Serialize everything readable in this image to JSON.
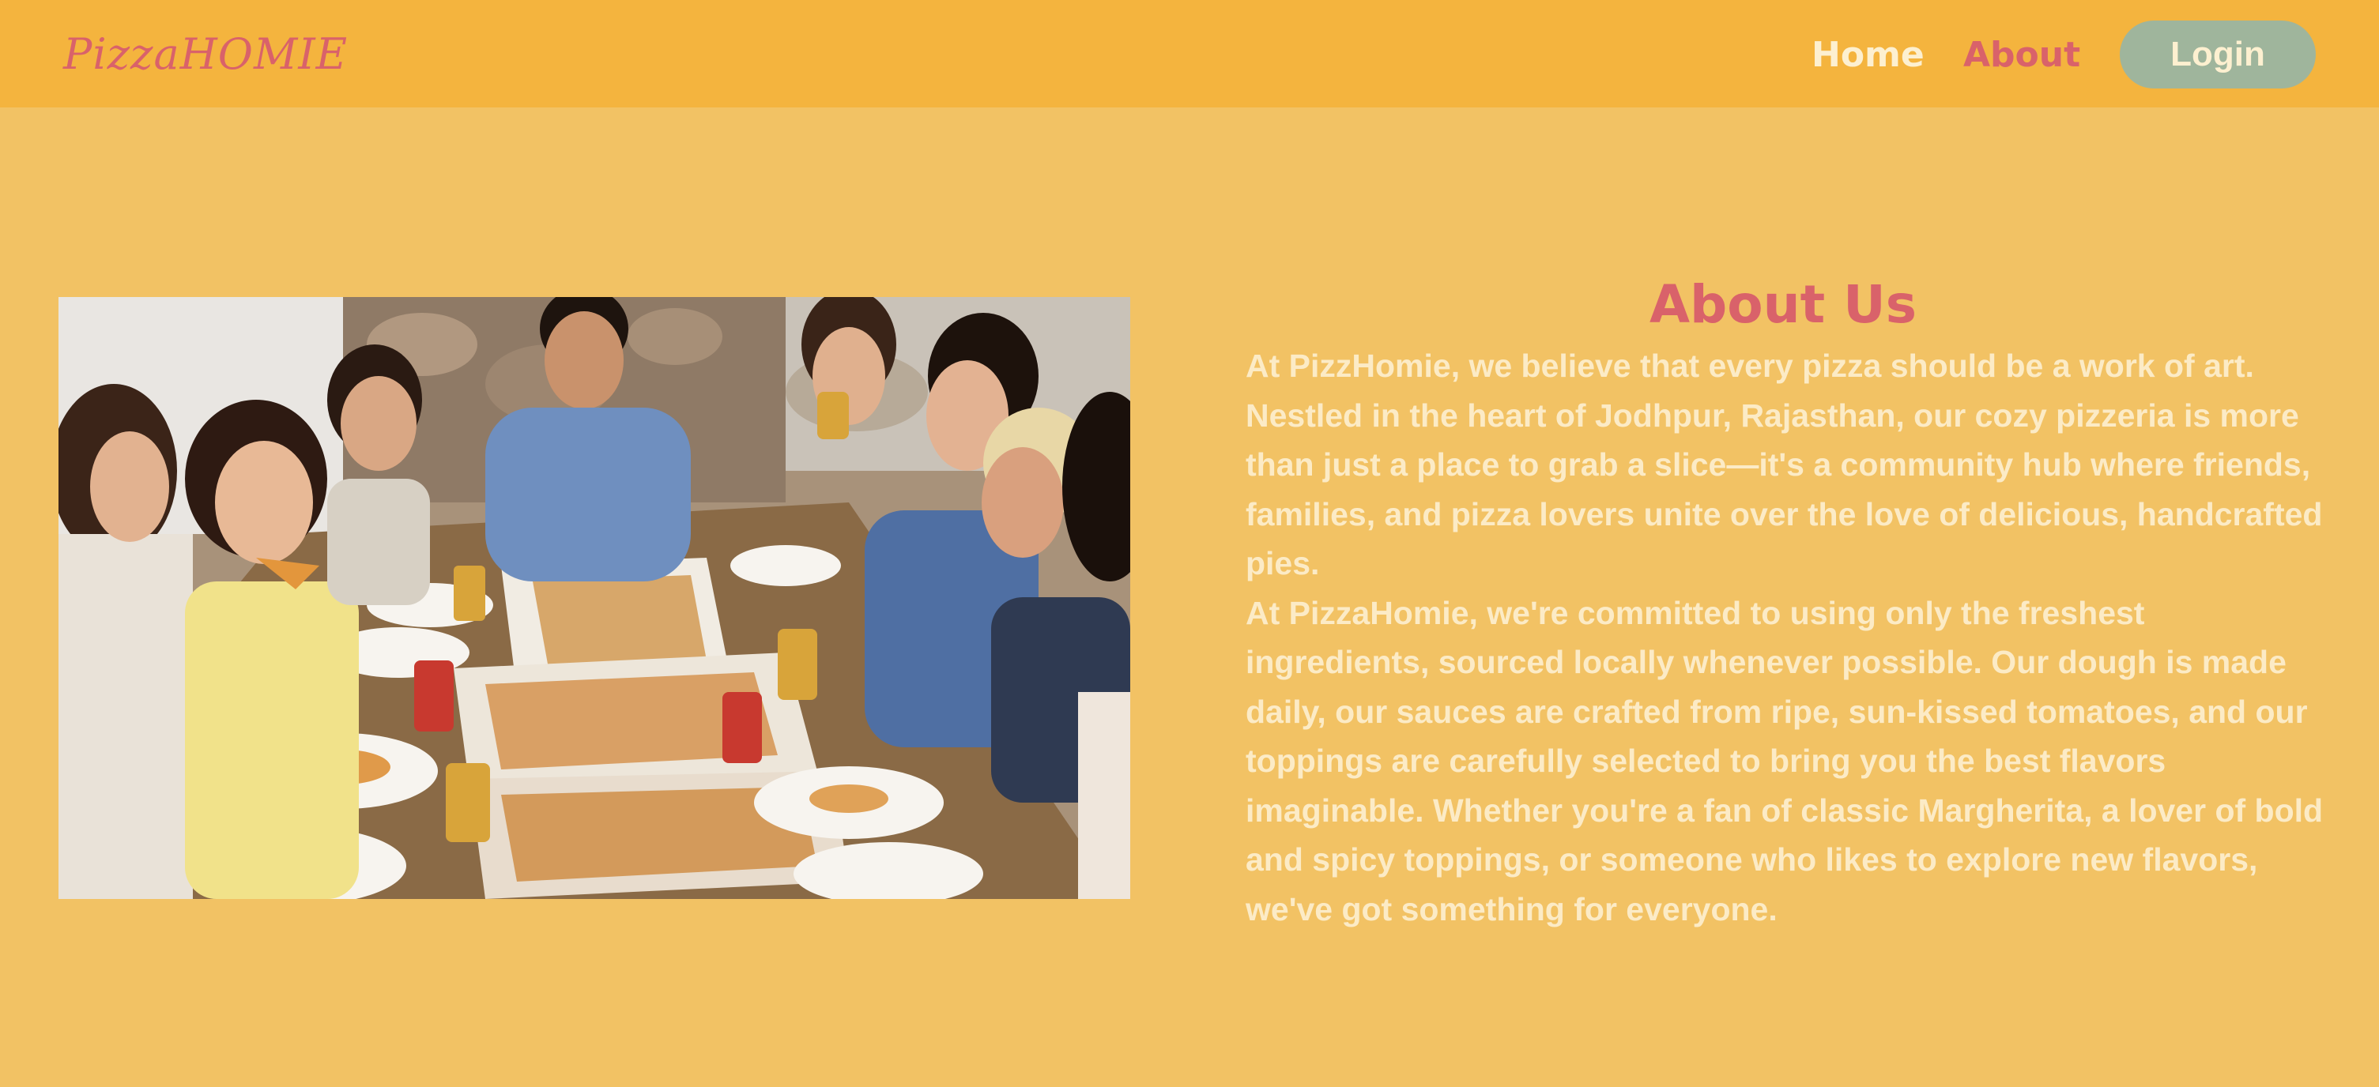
{
  "header": {
    "logo": "PizzaHOMIE",
    "nav": {
      "home": "Home",
      "about": "About",
      "login": "Login"
    }
  },
  "about": {
    "title": "About Us",
    "paragraph1": "At PizzHomie, we believe that every pizza should be a work of art. Nestled in the heart of Jodhpur, Rajasthan, our cozy pizzeria is more than just a place to grab a slice—it's a community hub where friends, families, and pizza lovers unite over the love of delicious, handcrafted pies.",
    "paragraph2": "At PizzaHomie, we're committed to using only the freshest ingredients, sourced locally whenever possible. Our dough is made daily, our sauces are crafted from ripe, sun-kissed tomatoes, and our toppings are carefully selected to bring you the best flavors imaginable. Whether you're a fan of classic Margherita, a lover of bold and spicy toppings, or someone who likes to explore new flavors, we've got something for everyone."
  },
  "colors": {
    "page_background": "#f2c264",
    "navbar_background": "#f4b43e",
    "accent": "#d9626a",
    "login_button": "#9fb59c",
    "body_text": "#fcebc6"
  },
  "image": {
    "subject": "group of friends eating pizza at a table"
  }
}
